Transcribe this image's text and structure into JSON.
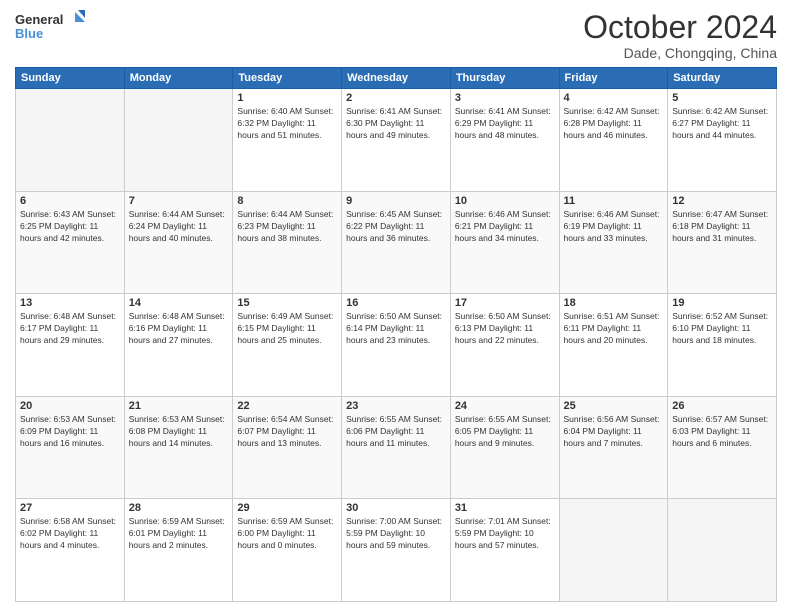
{
  "header": {
    "logo_line1": "General",
    "logo_line2": "Blue",
    "month": "October 2024",
    "location": "Dade, Chongqing, China"
  },
  "weekdays": [
    "Sunday",
    "Monday",
    "Tuesday",
    "Wednesday",
    "Thursday",
    "Friday",
    "Saturday"
  ],
  "weeks": [
    [
      {
        "day": "",
        "info": ""
      },
      {
        "day": "",
        "info": ""
      },
      {
        "day": "1",
        "info": "Sunrise: 6:40 AM\nSunset: 6:32 PM\nDaylight: 11 hours and 51 minutes."
      },
      {
        "day": "2",
        "info": "Sunrise: 6:41 AM\nSunset: 6:30 PM\nDaylight: 11 hours and 49 minutes."
      },
      {
        "day": "3",
        "info": "Sunrise: 6:41 AM\nSunset: 6:29 PM\nDaylight: 11 hours and 48 minutes."
      },
      {
        "day": "4",
        "info": "Sunrise: 6:42 AM\nSunset: 6:28 PM\nDaylight: 11 hours and 46 minutes."
      },
      {
        "day": "5",
        "info": "Sunrise: 6:42 AM\nSunset: 6:27 PM\nDaylight: 11 hours and 44 minutes."
      }
    ],
    [
      {
        "day": "6",
        "info": "Sunrise: 6:43 AM\nSunset: 6:25 PM\nDaylight: 11 hours and 42 minutes."
      },
      {
        "day": "7",
        "info": "Sunrise: 6:44 AM\nSunset: 6:24 PM\nDaylight: 11 hours and 40 minutes."
      },
      {
        "day": "8",
        "info": "Sunrise: 6:44 AM\nSunset: 6:23 PM\nDaylight: 11 hours and 38 minutes."
      },
      {
        "day": "9",
        "info": "Sunrise: 6:45 AM\nSunset: 6:22 PM\nDaylight: 11 hours and 36 minutes."
      },
      {
        "day": "10",
        "info": "Sunrise: 6:46 AM\nSunset: 6:21 PM\nDaylight: 11 hours and 34 minutes."
      },
      {
        "day": "11",
        "info": "Sunrise: 6:46 AM\nSunset: 6:19 PM\nDaylight: 11 hours and 33 minutes."
      },
      {
        "day": "12",
        "info": "Sunrise: 6:47 AM\nSunset: 6:18 PM\nDaylight: 11 hours and 31 minutes."
      }
    ],
    [
      {
        "day": "13",
        "info": "Sunrise: 6:48 AM\nSunset: 6:17 PM\nDaylight: 11 hours and 29 minutes."
      },
      {
        "day": "14",
        "info": "Sunrise: 6:48 AM\nSunset: 6:16 PM\nDaylight: 11 hours and 27 minutes."
      },
      {
        "day": "15",
        "info": "Sunrise: 6:49 AM\nSunset: 6:15 PM\nDaylight: 11 hours and 25 minutes."
      },
      {
        "day": "16",
        "info": "Sunrise: 6:50 AM\nSunset: 6:14 PM\nDaylight: 11 hours and 23 minutes."
      },
      {
        "day": "17",
        "info": "Sunrise: 6:50 AM\nSunset: 6:13 PM\nDaylight: 11 hours and 22 minutes."
      },
      {
        "day": "18",
        "info": "Sunrise: 6:51 AM\nSunset: 6:11 PM\nDaylight: 11 hours and 20 minutes."
      },
      {
        "day": "19",
        "info": "Sunrise: 6:52 AM\nSunset: 6:10 PM\nDaylight: 11 hours and 18 minutes."
      }
    ],
    [
      {
        "day": "20",
        "info": "Sunrise: 6:53 AM\nSunset: 6:09 PM\nDaylight: 11 hours and 16 minutes."
      },
      {
        "day": "21",
        "info": "Sunrise: 6:53 AM\nSunset: 6:08 PM\nDaylight: 11 hours and 14 minutes."
      },
      {
        "day": "22",
        "info": "Sunrise: 6:54 AM\nSunset: 6:07 PM\nDaylight: 11 hours and 13 minutes."
      },
      {
        "day": "23",
        "info": "Sunrise: 6:55 AM\nSunset: 6:06 PM\nDaylight: 11 hours and 11 minutes."
      },
      {
        "day": "24",
        "info": "Sunrise: 6:55 AM\nSunset: 6:05 PM\nDaylight: 11 hours and 9 minutes."
      },
      {
        "day": "25",
        "info": "Sunrise: 6:56 AM\nSunset: 6:04 PM\nDaylight: 11 hours and 7 minutes."
      },
      {
        "day": "26",
        "info": "Sunrise: 6:57 AM\nSunset: 6:03 PM\nDaylight: 11 hours and 6 minutes."
      }
    ],
    [
      {
        "day": "27",
        "info": "Sunrise: 6:58 AM\nSunset: 6:02 PM\nDaylight: 11 hours and 4 minutes."
      },
      {
        "day": "28",
        "info": "Sunrise: 6:59 AM\nSunset: 6:01 PM\nDaylight: 11 hours and 2 minutes."
      },
      {
        "day": "29",
        "info": "Sunrise: 6:59 AM\nSunset: 6:00 PM\nDaylight: 11 hours and 0 minutes."
      },
      {
        "day": "30",
        "info": "Sunrise: 7:00 AM\nSunset: 5:59 PM\nDaylight: 10 hours and 59 minutes."
      },
      {
        "day": "31",
        "info": "Sunrise: 7:01 AM\nSunset: 5:59 PM\nDaylight: 10 hours and 57 minutes."
      },
      {
        "day": "",
        "info": ""
      },
      {
        "day": "",
        "info": ""
      }
    ]
  ]
}
